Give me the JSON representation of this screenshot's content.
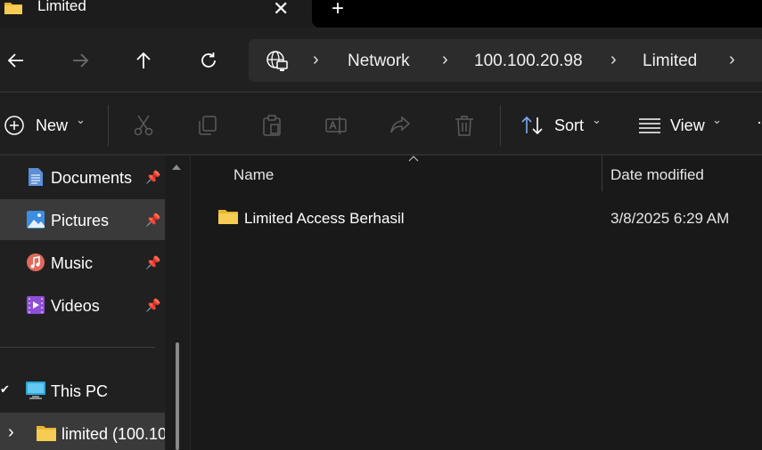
{
  "window": {
    "tab_title": "Limited",
    "close_glyph": "✕",
    "new_tab_glyph": "+"
  },
  "nav": {
    "back_icon": "arrow-left-icon",
    "forward_icon": "arrow-right-icon",
    "up_icon": "arrow-up-icon",
    "refresh_icon": "refresh-icon",
    "breadcrumbs": [
      "Network",
      "100.100.20.98",
      "Limited"
    ],
    "chevron": "›"
  },
  "toolbar": {
    "new_label": "New",
    "sort_label": "Sort",
    "view_label": "View",
    "caret": "⌄",
    "more": "⋯"
  },
  "sidebar": {
    "items": [
      {
        "label": "Documents",
        "icon": "documents-icon"
      },
      {
        "label": "Pictures",
        "icon": "pictures-icon"
      },
      {
        "label": "Music",
        "icon": "music-icon"
      },
      {
        "label": "Videos",
        "icon": "videos-icon"
      },
      {
        "label": "This PC",
        "icon": "this-pc-icon"
      },
      {
        "label": "limited (100.10",
        "icon": "folder-icon"
      }
    ],
    "pin_glyph": "📌",
    "check_glyph": "✔",
    "expand_glyph": "›"
  },
  "content": {
    "columns": [
      "Name",
      "Date modified"
    ],
    "sort_indicator": "^",
    "rows": [
      {
        "name": "Limited Access Berhasil",
        "date_modified": "3/8/2025 6:29 AM"
      }
    ]
  },
  "colors": {
    "background": "#191919",
    "sidebar": "#202020",
    "selected": "#3a3a3a",
    "folder": "#f4c33d"
  }
}
